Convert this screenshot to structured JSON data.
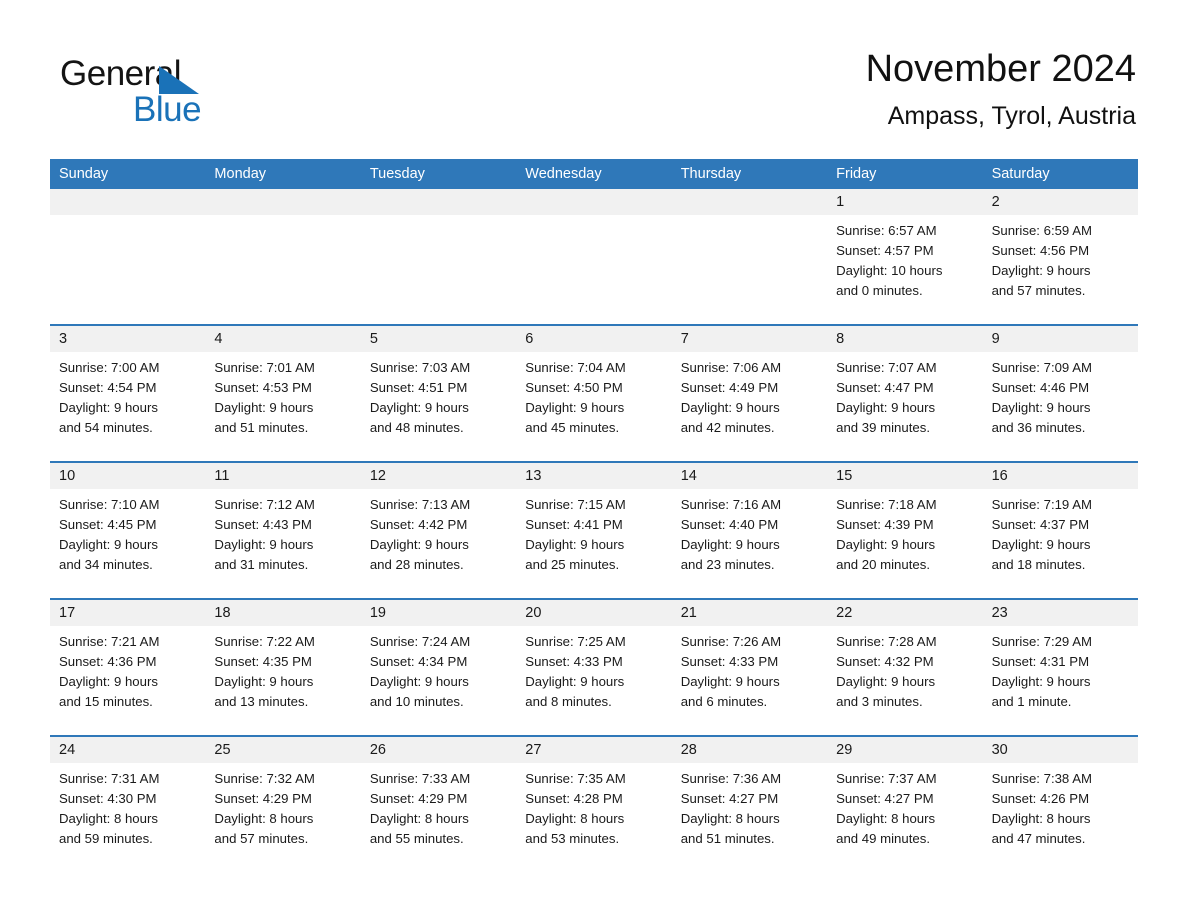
{
  "brand": {
    "name_part1": "General",
    "name_part2": "Blue",
    "triangle_color": "#1a72b8",
    "accent_color": "#2f78b9"
  },
  "header": {
    "title": "November 2024",
    "subtitle": "Ampass, Tyrol, Austria"
  },
  "weekdays": [
    "Sunday",
    "Monday",
    "Tuesday",
    "Wednesday",
    "Thursday",
    "Friday",
    "Saturday"
  ],
  "weeks": [
    [
      {
        "day": "",
        "lines": []
      },
      {
        "day": "",
        "lines": []
      },
      {
        "day": "",
        "lines": []
      },
      {
        "day": "",
        "lines": []
      },
      {
        "day": "",
        "lines": []
      },
      {
        "day": "1",
        "lines": [
          "Sunrise: 6:57 AM",
          "Sunset: 4:57 PM",
          "Daylight: 10 hours",
          "and 0 minutes."
        ]
      },
      {
        "day": "2",
        "lines": [
          "Sunrise: 6:59 AM",
          "Sunset: 4:56 PM",
          "Daylight: 9 hours",
          "and 57 minutes."
        ]
      }
    ],
    [
      {
        "day": "3",
        "lines": [
          "Sunrise: 7:00 AM",
          "Sunset: 4:54 PM",
          "Daylight: 9 hours",
          "and 54 minutes."
        ]
      },
      {
        "day": "4",
        "lines": [
          "Sunrise: 7:01 AM",
          "Sunset: 4:53 PM",
          "Daylight: 9 hours",
          "and 51 minutes."
        ]
      },
      {
        "day": "5",
        "lines": [
          "Sunrise: 7:03 AM",
          "Sunset: 4:51 PM",
          "Daylight: 9 hours",
          "and 48 minutes."
        ]
      },
      {
        "day": "6",
        "lines": [
          "Sunrise: 7:04 AM",
          "Sunset: 4:50 PM",
          "Daylight: 9 hours",
          "and 45 minutes."
        ]
      },
      {
        "day": "7",
        "lines": [
          "Sunrise: 7:06 AM",
          "Sunset: 4:49 PM",
          "Daylight: 9 hours",
          "and 42 minutes."
        ]
      },
      {
        "day": "8",
        "lines": [
          "Sunrise: 7:07 AM",
          "Sunset: 4:47 PM",
          "Daylight: 9 hours",
          "and 39 minutes."
        ]
      },
      {
        "day": "9",
        "lines": [
          "Sunrise: 7:09 AM",
          "Sunset: 4:46 PM",
          "Daylight: 9 hours",
          "and 36 minutes."
        ]
      }
    ],
    [
      {
        "day": "10",
        "lines": [
          "Sunrise: 7:10 AM",
          "Sunset: 4:45 PM",
          "Daylight: 9 hours",
          "and 34 minutes."
        ]
      },
      {
        "day": "11",
        "lines": [
          "Sunrise: 7:12 AM",
          "Sunset: 4:43 PM",
          "Daylight: 9 hours",
          "and 31 minutes."
        ]
      },
      {
        "day": "12",
        "lines": [
          "Sunrise: 7:13 AM",
          "Sunset: 4:42 PM",
          "Daylight: 9 hours",
          "and 28 minutes."
        ]
      },
      {
        "day": "13",
        "lines": [
          "Sunrise: 7:15 AM",
          "Sunset: 4:41 PM",
          "Daylight: 9 hours",
          "and 25 minutes."
        ]
      },
      {
        "day": "14",
        "lines": [
          "Sunrise: 7:16 AM",
          "Sunset: 4:40 PM",
          "Daylight: 9 hours",
          "and 23 minutes."
        ]
      },
      {
        "day": "15",
        "lines": [
          "Sunrise: 7:18 AM",
          "Sunset: 4:39 PM",
          "Daylight: 9 hours",
          "and 20 minutes."
        ]
      },
      {
        "day": "16",
        "lines": [
          "Sunrise: 7:19 AM",
          "Sunset: 4:37 PM",
          "Daylight: 9 hours",
          "and 18 minutes."
        ]
      }
    ],
    [
      {
        "day": "17",
        "lines": [
          "Sunrise: 7:21 AM",
          "Sunset: 4:36 PM",
          "Daylight: 9 hours",
          "and 15 minutes."
        ]
      },
      {
        "day": "18",
        "lines": [
          "Sunrise: 7:22 AM",
          "Sunset: 4:35 PM",
          "Daylight: 9 hours",
          "and 13 minutes."
        ]
      },
      {
        "day": "19",
        "lines": [
          "Sunrise: 7:24 AM",
          "Sunset: 4:34 PM",
          "Daylight: 9 hours",
          "and 10 minutes."
        ]
      },
      {
        "day": "20",
        "lines": [
          "Sunrise: 7:25 AM",
          "Sunset: 4:33 PM",
          "Daylight: 9 hours",
          "and 8 minutes."
        ]
      },
      {
        "day": "21",
        "lines": [
          "Sunrise: 7:26 AM",
          "Sunset: 4:33 PM",
          "Daylight: 9 hours",
          "and 6 minutes."
        ]
      },
      {
        "day": "22",
        "lines": [
          "Sunrise: 7:28 AM",
          "Sunset: 4:32 PM",
          "Daylight: 9 hours",
          "and 3 minutes."
        ]
      },
      {
        "day": "23",
        "lines": [
          "Sunrise: 7:29 AM",
          "Sunset: 4:31 PM",
          "Daylight: 9 hours",
          "and 1 minute."
        ]
      }
    ],
    [
      {
        "day": "24",
        "lines": [
          "Sunrise: 7:31 AM",
          "Sunset: 4:30 PM",
          "Daylight: 8 hours",
          "and 59 minutes."
        ]
      },
      {
        "day": "25",
        "lines": [
          "Sunrise: 7:32 AM",
          "Sunset: 4:29 PM",
          "Daylight: 8 hours",
          "and 57 minutes."
        ]
      },
      {
        "day": "26",
        "lines": [
          "Sunrise: 7:33 AM",
          "Sunset: 4:29 PM",
          "Daylight: 8 hours",
          "and 55 minutes."
        ]
      },
      {
        "day": "27",
        "lines": [
          "Sunrise: 7:35 AM",
          "Sunset: 4:28 PM",
          "Daylight: 8 hours",
          "and 53 minutes."
        ]
      },
      {
        "day": "28",
        "lines": [
          "Sunrise: 7:36 AM",
          "Sunset: 4:27 PM",
          "Daylight: 8 hours",
          "and 51 minutes."
        ]
      },
      {
        "day": "29",
        "lines": [
          "Sunrise: 7:37 AM",
          "Sunset: 4:27 PM",
          "Daylight: 8 hours",
          "and 49 minutes."
        ]
      },
      {
        "day": "30",
        "lines": [
          "Sunrise: 7:38 AM",
          "Sunset: 4:26 PM",
          "Daylight: 8 hours",
          "and 47 minutes."
        ]
      }
    ]
  ]
}
